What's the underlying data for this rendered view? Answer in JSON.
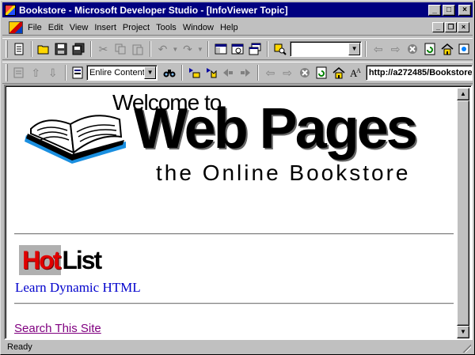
{
  "window": {
    "title": "Bookstore - Microsoft Developer Studio - [InfoViewer Topic]",
    "buttons": {
      "minimize": "_",
      "maximize": "□",
      "close": "×"
    }
  },
  "menubar": {
    "items": [
      "File",
      "Edit",
      "View",
      "Insert",
      "Project",
      "Tools",
      "Window",
      "Help"
    ],
    "mdi_buttons": {
      "minimize": "_",
      "restore": "❐",
      "close": "×"
    }
  },
  "toolbar2": {
    "contents_select": "Enlire Contents",
    "url": "http://a272485/Bookstore"
  },
  "page": {
    "welcome": "Welcome to",
    "heading": "Web Pages",
    "subtitle": "the Online Bookstore",
    "hot": "Hot",
    "list": "List",
    "link_dhtml": "Learn Dynamic HTML",
    "link_search": "Search This Site"
  },
  "status": {
    "text": "Ready"
  },
  "colors": {
    "titlebar": "#000080",
    "link": "#0000cc",
    "visited_link": "#800080",
    "hot_red": "#e00000"
  },
  "icons": [
    "new-text-file-icon",
    "open-folder-icon",
    "save-icon",
    "save-all-icon",
    "cut-icon",
    "copy-icon",
    "paste-icon",
    "undo-icon",
    "redo-icon",
    "workspace-icon",
    "output-icon",
    "window-list-icon",
    "find-in-files-icon",
    "back-arrow-icon",
    "forward-arrow-icon",
    "stop-icon",
    "refresh-icon",
    "home-icon",
    "open-url-icon",
    "book-icon"
  ]
}
